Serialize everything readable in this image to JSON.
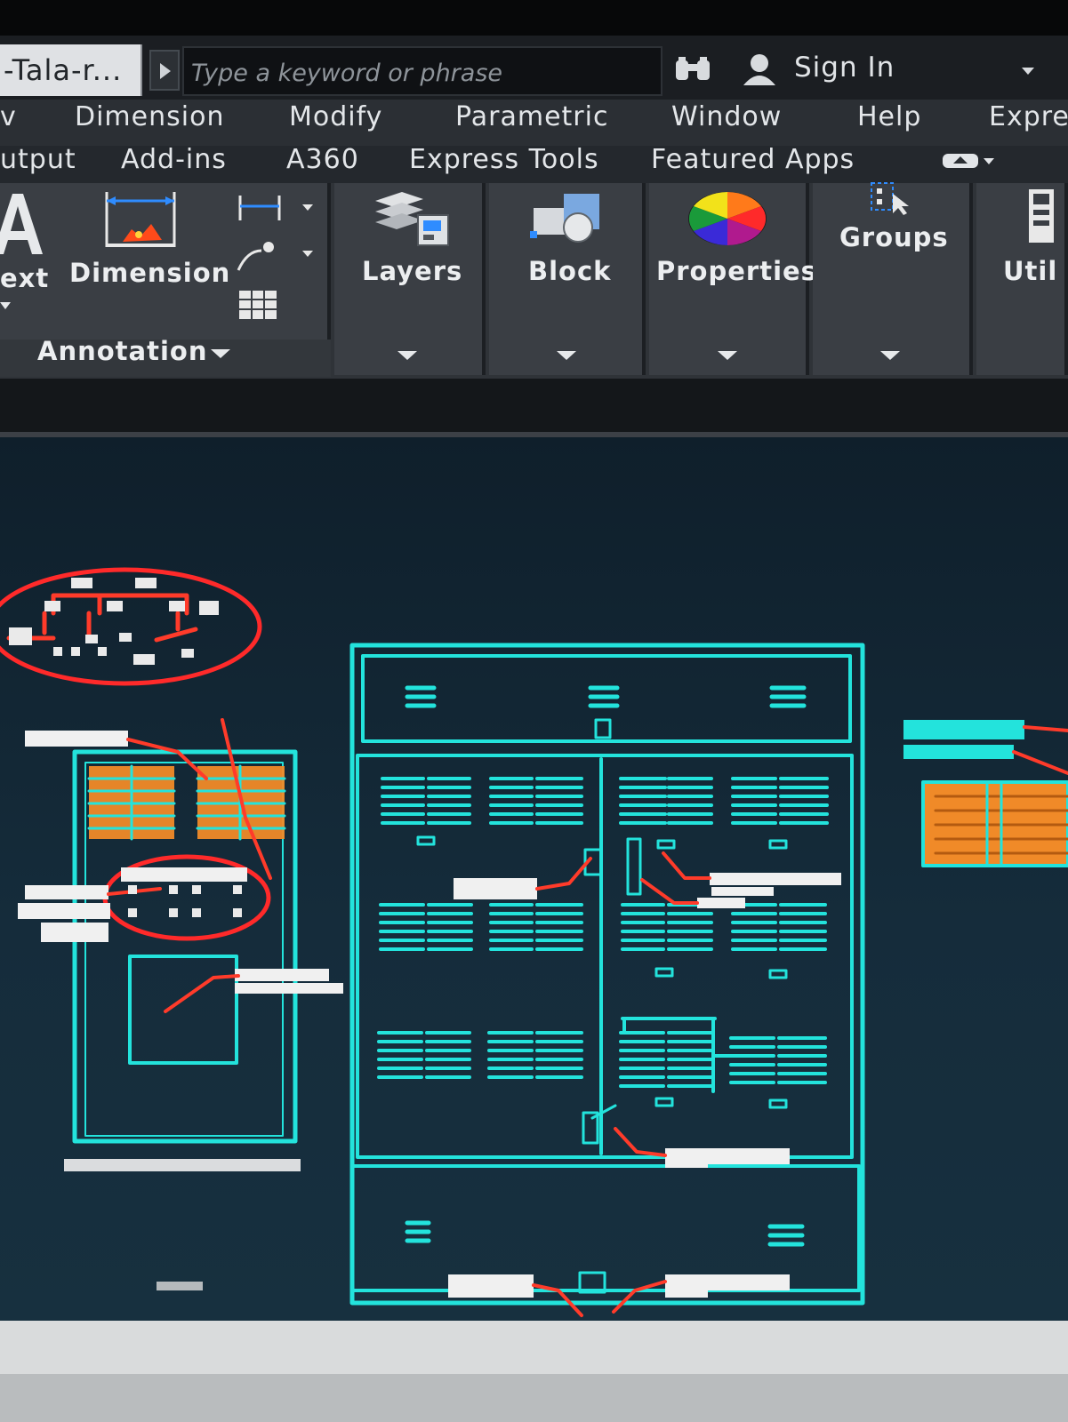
{
  "title_bar": {
    "document_tab": "-Tala-r...",
    "search_placeholder": "Type a keyword or phrase",
    "sign_in": "Sign In"
  },
  "menu_bar": {
    "items": [
      "v",
      "Dimension",
      "Modify",
      "Parametric",
      "Window",
      "Help",
      "Expre"
    ]
  },
  "ribbon_tabs": {
    "items": [
      "utput",
      "Add-ins",
      "A360",
      "Express Tools",
      "Featured Apps"
    ]
  },
  "ribbon": {
    "text_label": "ext",
    "dimension_label": "Dimension",
    "annotation_label": "Annotation",
    "layers_label": "Layers",
    "block_label": "Block",
    "properties_label": "Properties",
    "groups_label": "Groups",
    "utilities_label": "Util"
  },
  "icons": {
    "text": "text-A-icon",
    "dimension": "dimension-icon",
    "linear": "linear-dimension-icon",
    "leader": "leader-icon",
    "table": "table-icon",
    "layers": "layers-icon",
    "block": "block-icon",
    "properties": "color-wheel-icon",
    "groups": "groups-icon",
    "utilities": "calculator-icon",
    "search": "binoculars-icon",
    "user": "user-icon"
  },
  "colors": {
    "drawing_cyan": "#23e3dc",
    "annotation_red": "#ff2a2a",
    "hatch_orange": "#f08a28",
    "canvas_bg": "#132837",
    "ribbon_panel": "#3a3e44"
  }
}
